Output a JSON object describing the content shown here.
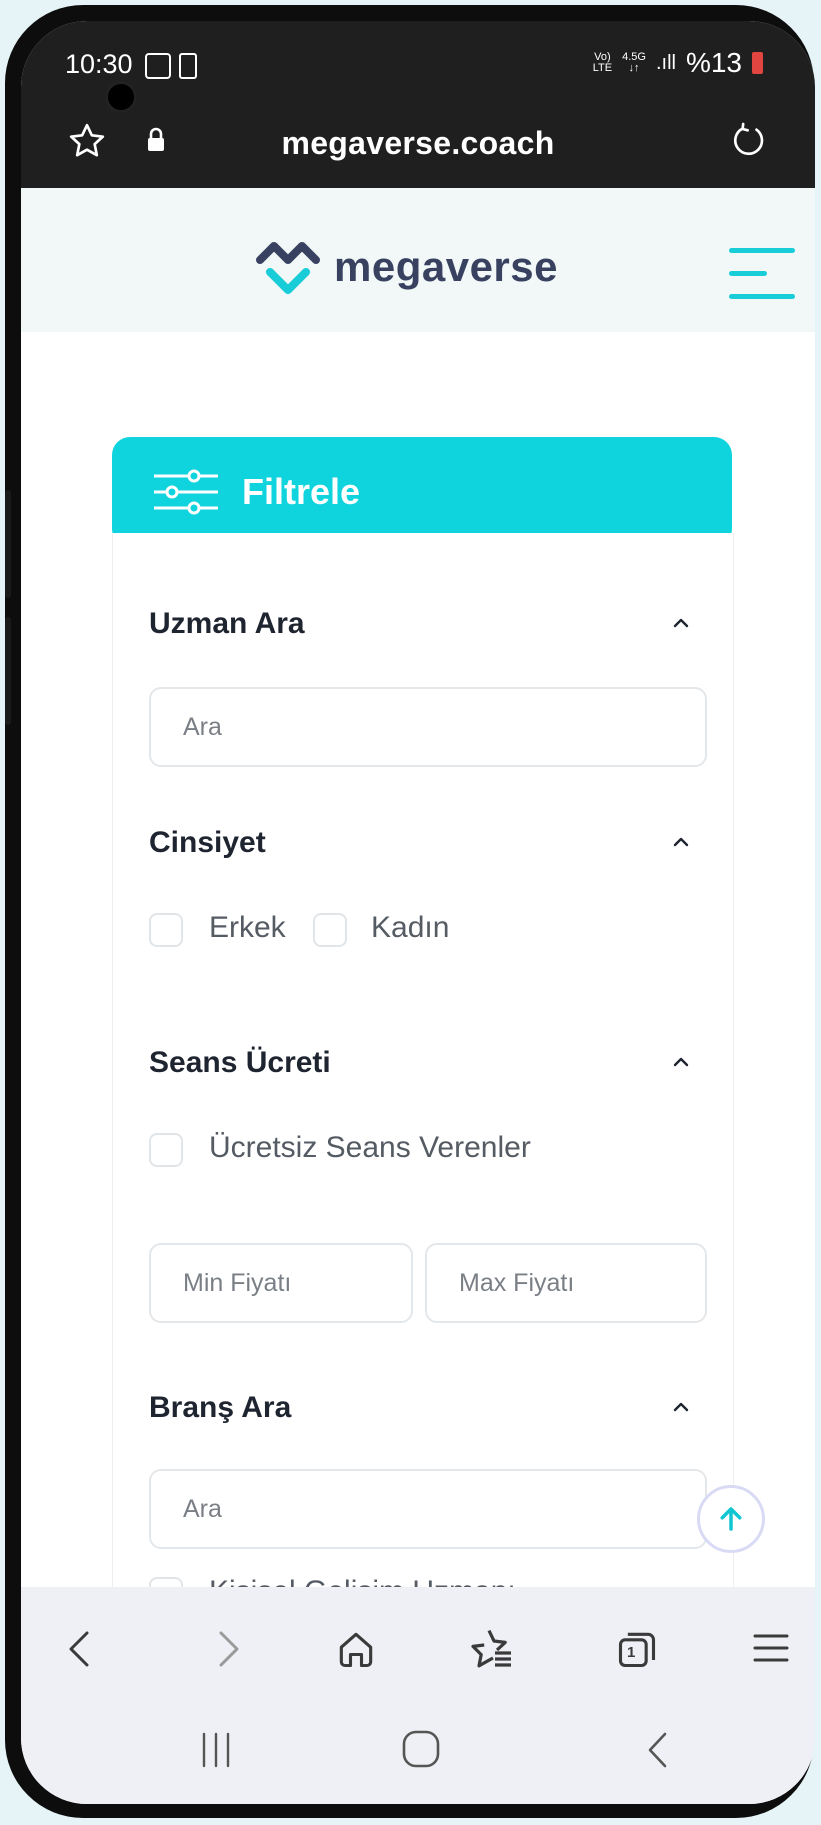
{
  "status_bar": {
    "time": "10:30",
    "network_top": "Vo)",
    "network_bottom": "LTE",
    "data_top": "4.5G",
    "data_bottom": "↓↑",
    "signal": ".ıll",
    "battery": "%13"
  },
  "browser": {
    "url": "megaverse.coach"
  },
  "site": {
    "logo_text": "megaverse",
    "accent_color": "#10d4dd"
  },
  "filter": {
    "title": "Filtrele",
    "search_expert": {
      "title": "Uzman Ara",
      "placeholder": "Ara"
    },
    "gender": {
      "title": "Cinsiyet",
      "options": [
        "Erkek",
        "Kadın"
      ]
    },
    "session_fee": {
      "title": "Seans Ücreti",
      "free_option": "Ücretsiz Seans Verenler",
      "min_placeholder": "Min Fiyatı",
      "max_placeholder": "Max Fiyatı"
    },
    "branch": {
      "title": "Branş Ara",
      "placeholder": "Ara",
      "first_option": "Kişisel Gelişim Uzmanı"
    }
  },
  "icons": {
    "star": "star-icon",
    "lock": "lock-icon",
    "reload": "reload-icon",
    "menu": "hamburger-icon",
    "filter": "sliders-icon",
    "chevron": "chevron-up-icon",
    "scroll_top": "arrow-up-icon",
    "back": "back-icon",
    "forward": "forward-icon",
    "home": "home-icon",
    "bookmarks": "bookmarks-icon",
    "tabs": "tabs-icon",
    "more": "menu-icon"
  },
  "tabs_count": "1"
}
